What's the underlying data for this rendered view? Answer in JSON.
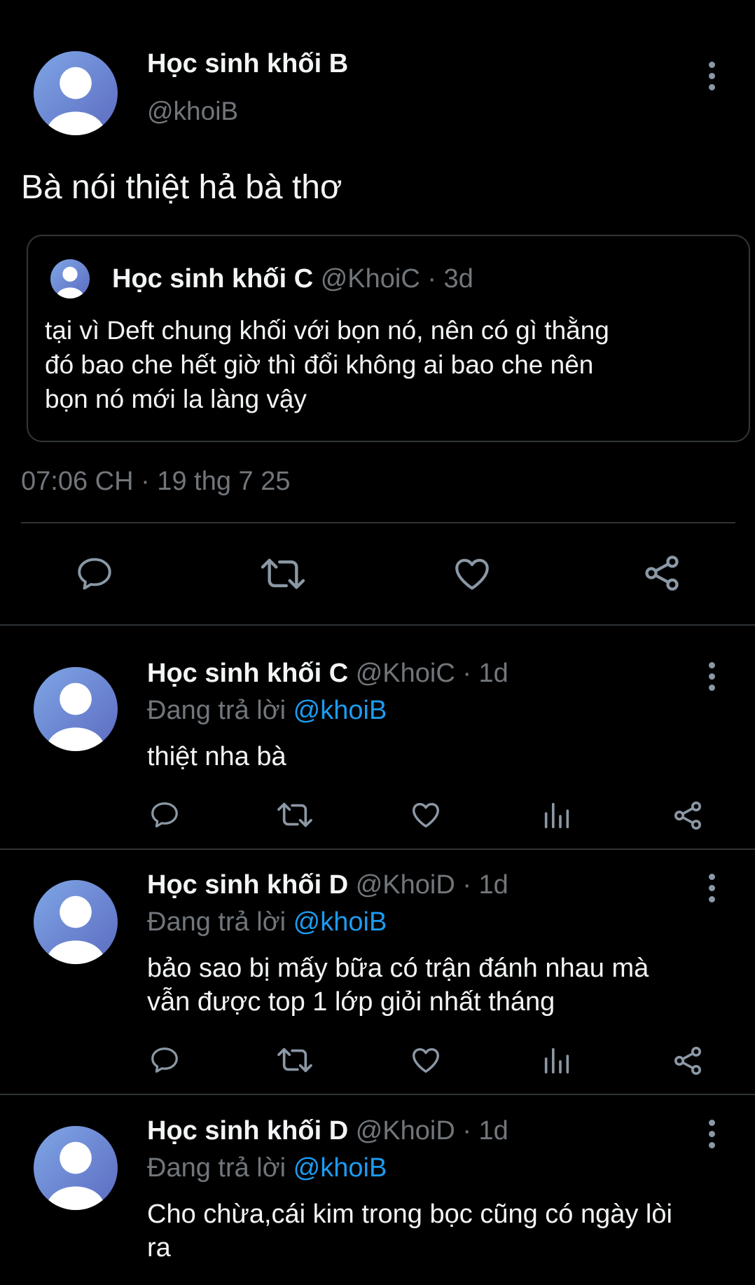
{
  "main_tweet": {
    "author_name": "Học sinh khối B",
    "handle": "@khoiB",
    "text": "Bà nói thiệt hả bà thơ",
    "quote": {
      "author_name": "Học sinh khối C",
      "handle": "@KhoiC",
      "age": "· 3d",
      "text_lines": [
        "tại vì Deft chung khối với bọn nó, nên có gì thằng",
        "đó bao che hết giờ thì đổi không ai bao che nên",
        "bọn nó mới la làng vậy"
      ]
    },
    "timestamp": "07:06 CH · 19 thg 7 25"
  },
  "replies": [
    {
      "author_name": "Học sinh khối C",
      "handle_age": "@KhoiC · 1d",
      "replying_prefix": "Đang trả lời",
      "replying_to": "@khoiB",
      "text_lines": [
        "thiệt nha bà"
      ]
    },
    {
      "author_name": "Học sinh khối D",
      "handle_age": "@KhoiD · 1d",
      "replying_prefix": "Đang trả lời",
      "replying_to": "@khoiB",
      "text_lines": [
        "bảo sao bị mấy bữa có trận đánh nhau mà",
        "vẫn được top 1 lớp giỏi nhất tháng"
      ]
    },
    {
      "author_name": "Học sinh khối D",
      "handle_age": "@KhoiD · 1d",
      "replying_prefix": "Đang trả lời",
      "replying_to": "@khoiB",
      "text_lines": [
        "Cho chừa,cái kim trong bọc cũng có ngày lòi",
        "ra"
      ]
    }
  ],
  "icons": {
    "reply": "speech-bubble-icon",
    "retweet": "retweet-icon",
    "like": "heart-icon",
    "views": "bar-chart-icon",
    "share": "share-icon",
    "more": "three-dots-vertical-icon"
  },
  "colors": {
    "background": "#000000",
    "text": "#e7e9ea",
    "muted": "#71767b",
    "link": "#1d9bf0",
    "divider": "#2f3336"
  }
}
